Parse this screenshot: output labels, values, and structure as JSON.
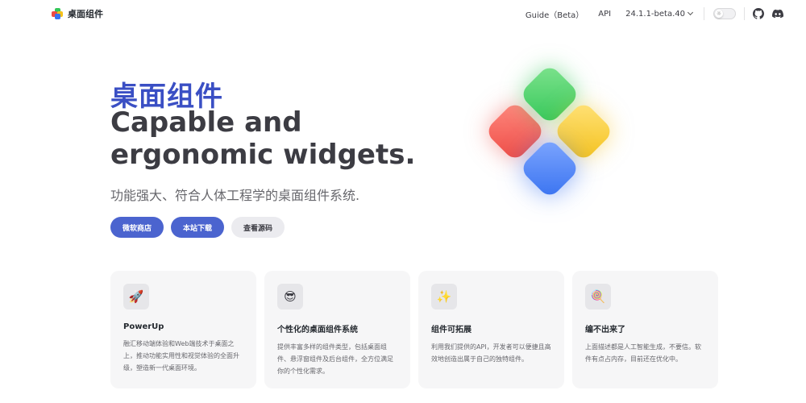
{
  "nav": {
    "brand": "桌面组件",
    "links": [
      "Guide（Beta）",
      "API"
    ],
    "version": "24.1.1-beta.40",
    "theme_icon": "sun-icon",
    "social": [
      "github-icon",
      "discord-icon"
    ]
  },
  "hero": {
    "name": "桌面组件",
    "text_line1": "Capable and",
    "text_line2": "ergonomic widgets.",
    "tagline": "功能强大、符合人体工程学的桌面组件系统.",
    "actions": [
      "微软商店",
      "本站下载",
      "查看源码"
    ]
  },
  "features": [
    {
      "icon": "rocket-icon",
      "glyph": "🚀",
      "title": "PowerUp",
      "details": "融汇移动端体验和Web端技术于桌面之上，推动功能实用性和视觉体验的全面升级，塑造新一代桌面环境。"
    },
    {
      "icon": "sunglasses-face-icon",
      "glyph": "😎",
      "title": "个性化的桌面组件系统",
      "details": "提供丰富多样的组件类型，包括桌面组件、悬浮窗组件及后台组件，全方位满足你的个性化需求。"
    },
    {
      "icon": "sparkles-icon",
      "glyph": "✨",
      "title": "组件可拓展",
      "details": "利用我们提供的API，开发者可以便捷且高效地创造出属于自己的独特组件。"
    },
    {
      "icon": "lollipop-icon",
      "glyph": "🍭",
      "title": "编不出来了",
      "details": "上面描述都是人工智能生成，不要信。软件有点占内存，目前还在优化中。"
    }
  ],
  "colors": {
    "brand": "#3a4fc4",
    "button": "#4b64cf"
  }
}
